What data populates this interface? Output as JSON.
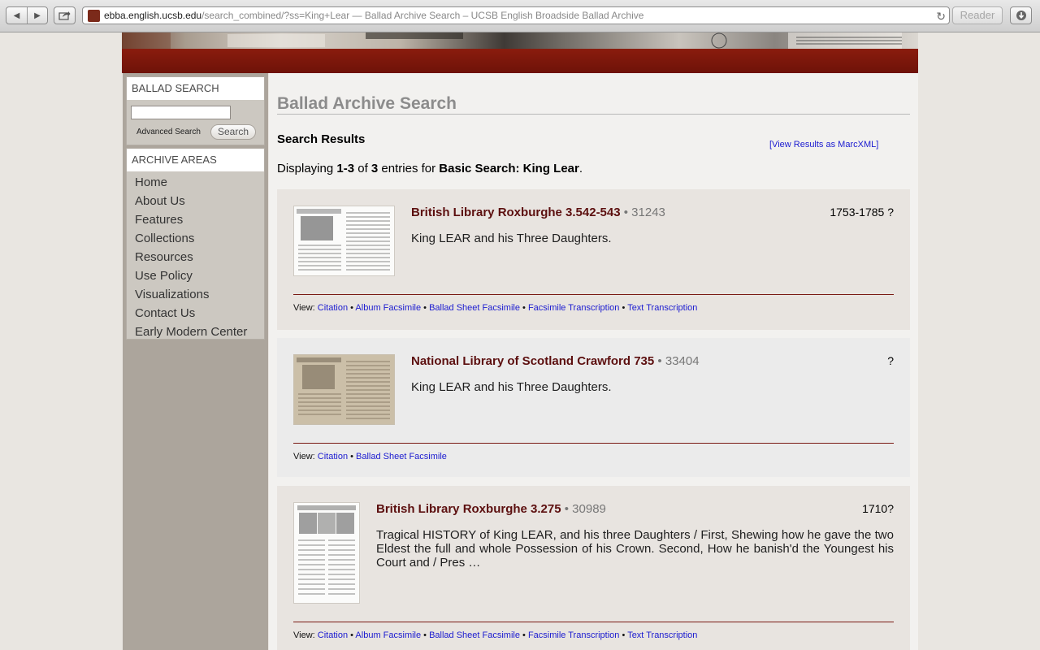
{
  "browser": {
    "url_domain": "ebba.english.ucsb.edu",
    "url_path": "/search_combined/?ss=King+Lear",
    "url_separator": " — ",
    "page_title": "Ballad Archive Search – UCSB English Broadside Ballad Archive",
    "reader_label": "Reader"
  },
  "sidebar": {
    "search_heading": "BALLAD SEARCH",
    "search_value": "",
    "advanced_label": "Advanced Search",
    "search_button": "Search",
    "areas_heading": "ARCHIVE AREAS",
    "nav": [
      "Home",
      "About Us",
      "Features",
      "Collections",
      "Resources",
      "Use Policy",
      "Visualizations",
      "Contact Us",
      "Early Modern Center"
    ]
  },
  "main": {
    "title": "Ballad Archive Search",
    "results_heading": "Search Results",
    "marc_link": "[View Results as MarcXML]",
    "display_prefix": "Displaying ",
    "display_range": "1-3",
    "display_of": " of ",
    "display_total": "3",
    "display_entries": " entries for ",
    "display_query": "Basic Search: King Lear",
    "display_end": ".",
    "view_label": "View: ",
    "bullet": " • "
  },
  "results": [
    {
      "title": "British Library Roxburghe 3.542-543",
      "id": " • 31243",
      "date": "1753-1785 ?",
      "description": "King LEAR and his Three Daughters.",
      "links": [
        "Citation",
        "Album Facsimile",
        "Ballad Sheet Facsimile",
        "Facsimile Transcription",
        "Text Transcription"
      ]
    },
    {
      "title": "National Library of Scotland Crawford 735",
      "id": " • 33404",
      "date": "?",
      "description": "King LEAR and his Three Daughters.",
      "links": [
        "Citation",
        "Ballad Sheet Facsimile"
      ]
    },
    {
      "title": "British Library Roxburghe 3.275",
      "id": " • 30989",
      "date": "1710?",
      "description": "Tragical HISTORY of King LEAR, and his three Daughters / First, Shewing how he gave the two Eldest the full and whole Possession of his Crown. Second, How he banish'd the Youngest his Court and / Pres …",
      "links": [
        "Citation",
        "Album Facsimile",
        "Ballad Sheet Facsimile",
        "Facsimile Transcription",
        "Text Transcription"
      ]
    }
  ]
}
